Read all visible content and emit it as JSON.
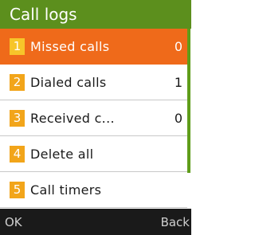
{
  "header": {
    "title": "Call logs"
  },
  "menu": {
    "items": [
      {
        "number": "1",
        "label": "Missed calls",
        "count": "0",
        "selected": true
      },
      {
        "number": "2",
        "label": "Dialed calls",
        "count": "1",
        "selected": false
      },
      {
        "number": "3",
        "label": "Received c...",
        "count": "0",
        "selected": false
      },
      {
        "number": "4",
        "label": "Delete all",
        "count": "",
        "selected": false
      },
      {
        "number": "5",
        "label": "Call timers",
        "count": "",
        "selected": false
      }
    ]
  },
  "softkeys": {
    "left": "OK",
    "right": "Back"
  },
  "colors": {
    "header_bg": "#5c8f1d",
    "selected_bg": "#ef6a1a",
    "number_badge": "#f2a51a",
    "scroll_thumb": "#5f9d1a",
    "softkey_bg": "#1a1a1a"
  }
}
